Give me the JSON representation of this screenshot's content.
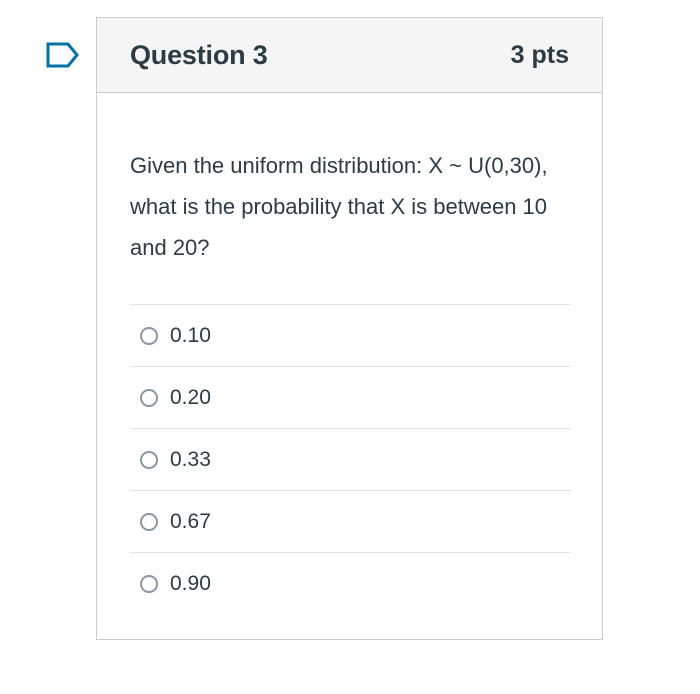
{
  "question": {
    "title": "Question 3",
    "points": "3 pts",
    "text": "Given the uniform distribution: X ~ U(0,30), what is the probability that X is between 10 and 20?",
    "answers": [
      {
        "label": "0.10"
      },
      {
        "label": "0.20"
      },
      {
        "label": "0.33"
      },
      {
        "label": "0.67"
      },
      {
        "label": "0.90"
      }
    ]
  },
  "colors": {
    "flag": "#0770a3",
    "text": "#2d3b45",
    "header_bg": "#f5f5f5",
    "border": "#c7cdd1"
  },
  "icons": {
    "flag": "flag-question-icon",
    "radio": "radio-unchecked-icon"
  }
}
